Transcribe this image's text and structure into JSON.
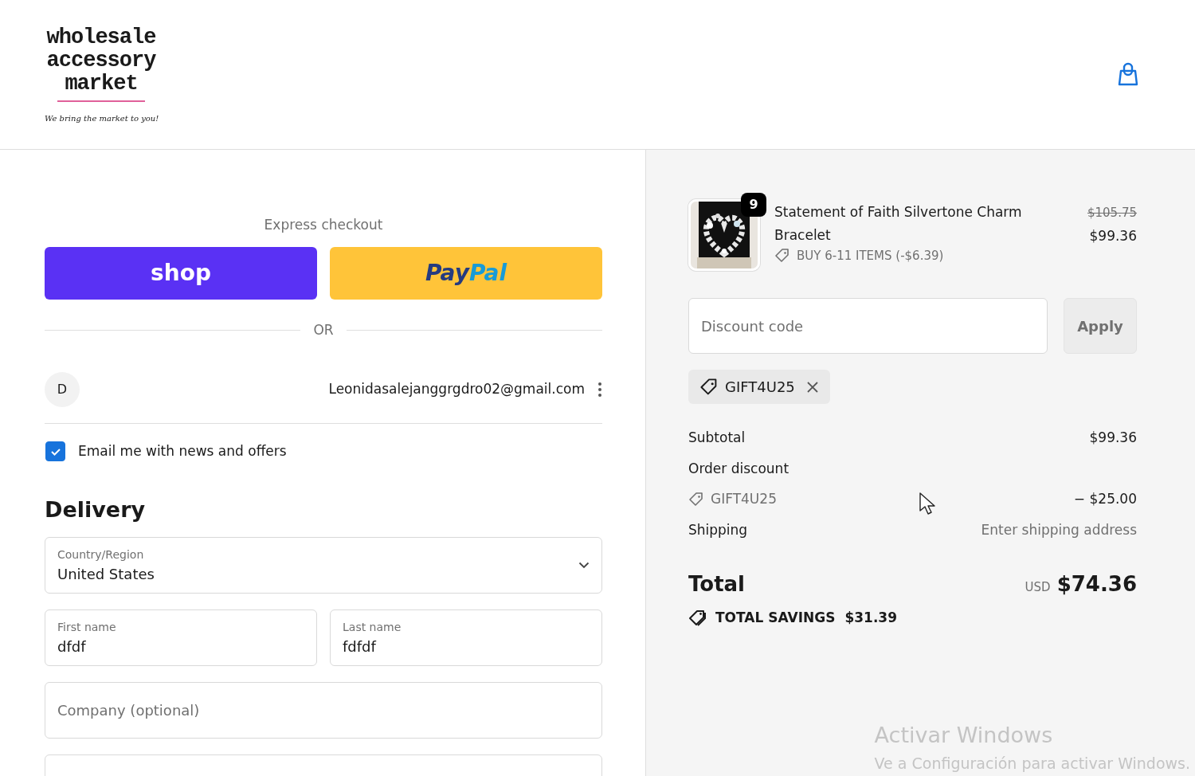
{
  "header": {
    "logo": {
      "lines": [
        "wholesale",
        "accessory",
        "market"
      ],
      "tagline": "We bring the market to you!"
    }
  },
  "express_checkout": {
    "title": "Express checkout",
    "shop_button": "shop",
    "paypal_button": [
      "Pay",
      "Pal"
    ],
    "divider": "OR"
  },
  "contact": {
    "avatar": "D",
    "email": "Leonidasalejanggrgdro02@gmail.com",
    "newsletter": {
      "label": "Email me with news and offers",
      "checked": true
    }
  },
  "delivery": {
    "title": "Delivery",
    "fields": [
      {
        "kind": "select",
        "label": "Country/Region",
        "value": "United States"
      },
      {
        "kind": "text",
        "label": "First name",
        "value": "dfdf"
      },
      {
        "kind": "text",
        "label": "Last name",
        "value": "fdfdf"
      },
      {
        "kind": "text",
        "placeholder": "Company (optional)"
      }
    ]
  },
  "summary": {
    "item": {
      "quantity": "9",
      "name": "Statement of Faith Silvertone Charm Bracelet",
      "discount": "BUY 6-11 ITEMS (-$6.39)",
      "original_price": "$105.75",
      "price": "$99.36"
    },
    "discount_field": {
      "placeholder": "Discount code",
      "button": "Apply"
    },
    "applied_code": "GIFT4U25",
    "rows": [
      {
        "kind": "line",
        "label": "Subtotal",
        "value": "$99.36"
      },
      {
        "kind": "heading",
        "label": "Order discount"
      },
      {
        "kind": "code",
        "label": "GIFT4U25",
        "value": "− $25.00"
      },
      {
        "kind": "muted",
        "label": "Shipping",
        "value": "Enter shipping address"
      }
    ],
    "total": {
      "label": "Total",
      "currency": "USD",
      "value": "$74.36"
    },
    "savings": {
      "label": "TOTAL SAVINGS",
      "value": "$31.39"
    }
  },
  "windows_notice": {
    "title": "Activar Windows",
    "text": "Ve a Configuración para activar Windows."
  }
}
